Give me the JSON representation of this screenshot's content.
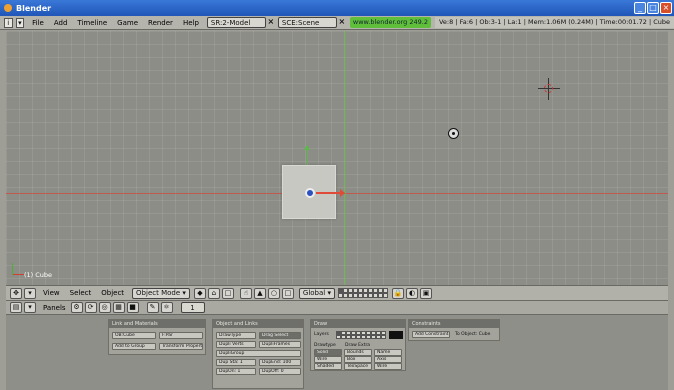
{
  "window": {
    "title": "Blender",
    "controls": [
      "_",
      "□",
      "×"
    ]
  },
  "header": {
    "menus": [
      "File",
      "Add",
      "Timeline",
      "Game",
      "Render",
      "Help"
    ],
    "screen_field": "SR:2-Model",
    "scene_field": "SCE:Scene",
    "url": "www.blender.org 249.2",
    "stats": "Ve:8 | Fa:6 | Ob:3-1 | La:1 | Mem:1.06M (0.24M) | Time:00:01.72 | Cube"
  },
  "viewport": {
    "object_label": "(1) Cube"
  },
  "view_header": {
    "menus": [
      "View",
      "Select",
      "Object"
    ],
    "mode": "Object Mode",
    "orientation": "Global"
  },
  "buttons_header": {
    "panels_label": "Panels",
    "frame": "1"
  },
  "panels": {
    "link_scale": {
      "title": "Link and Materials",
      "ob_field": "OB:Cube",
      "par_field": "F:Par",
      "add_group": "Add to Group",
      "transform": "Transform Properties"
    },
    "object": {
      "title": "Object and Links",
      "draw": "DrawType",
      "btn1": "Drag Select",
      "btn2": "Dupli Verts",
      "btn3": "DupliFrames",
      "btn4": "DupliGroup",
      "btn5": "Dup Sta: 1",
      "btn6": "DupEnd: 100",
      "btn7": "DupOn: 1",
      "btn8": "DupOff: 0"
    },
    "draw_panel": {
      "title": "Draw",
      "layers_label": "Layers",
      "drawtype": "Drawtype",
      "draw_extra": "Draw Extra",
      "btns": [
        "Solid",
        "Bounds",
        "Name",
        "Wire",
        "Box",
        "Axis",
        "Shaded",
        "TexSpace",
        "Wire"
      ]
    },
    "constraints": {
      "title": "Constraints",
      "add_btn": "Add Constraint",
      "to_label": "To Object: Cube"
    }
  }
}
